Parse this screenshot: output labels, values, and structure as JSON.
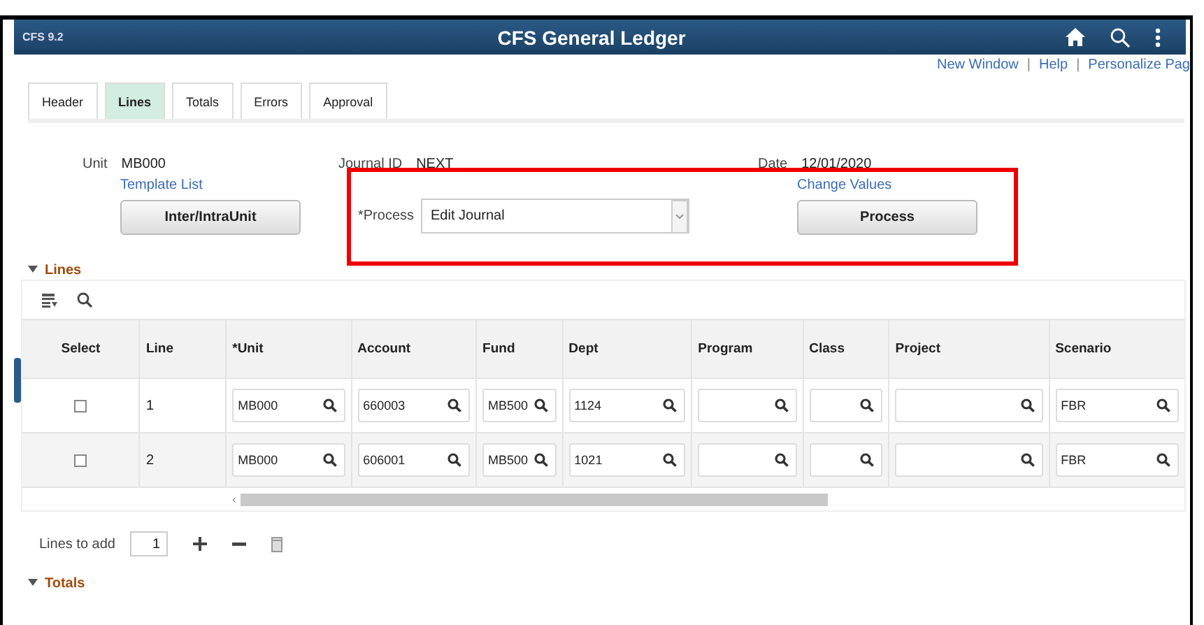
{
  "banner": {
    "back_label": "CFS 9.2",
    "title": "CFS General Ledger"
  },
  "links": [
    {
      "label": "New Window",
      "separator": "|"
    },
    {
      "label": "Help",
      "separator": "|"
    },
    {
      "label": "Personalize Pag"
    }
  ],
  "tabs": [
    {
      "label": "Header",
      "selected": false
    },
    {
      "label": "Lines",
      "selected": true
    },
    {
      "label": "Totals",
      "selected": false
    },
    {
      "label": "Errors",
      "selected": false
    },
    {
      "label": "Approval",
      "selected": false
    }
  ],
  "form": {
    "unit_label": "Unit",
    "unit_value": "MB000",
    "template_link": "Template List",
    "interunit_button": "Inter/IntraUnit",
    "journal_id_label": "Journal ID",
    "journal_id_value": "NEXT",
    "process_label": "*Process",
    "process_value": "Edit Journal",
    "date_label": "Date",
    "date_value": "12/01/2020",
    "change_values_link": "Change Values",
    "process_button": "Process"
  },
  "lines": {
    "title": "Lines",
    "expanded": true,
    "columns": [
      "Select",
      "Line",
      "*Unit",
      "Account",
      "Fund",
      "Dept",
      "Program",
      "Class",
      "Project",
      "Scenario"
    ],
    "rows": [
      {
        "selected": false,
        "line": "1",
        "unit": "MB000",
        "account": "660003",
        "fund": "MB500",
        "dept": "1124",
        "program": "",
        "class": "",
        "project": "",
        "scenario": "FBR"
      },
      {
        "selected": false,
        "line": "2",
        "unit": "MB000",
        "account": "606001",
        "fund": "MB500",
        "dept": "1021",
        "program": "",
        "class": "",
        "project": "",
        "scenario": "FBR"
      }
    ],
    "scroll_arrow": "‹",
    "lines_to_add_label": "Lines to add",
    "lines_to_add_value": "1"
  },
  "totals": {
    "title": "Totals",
    "expanded": true
  }
}
